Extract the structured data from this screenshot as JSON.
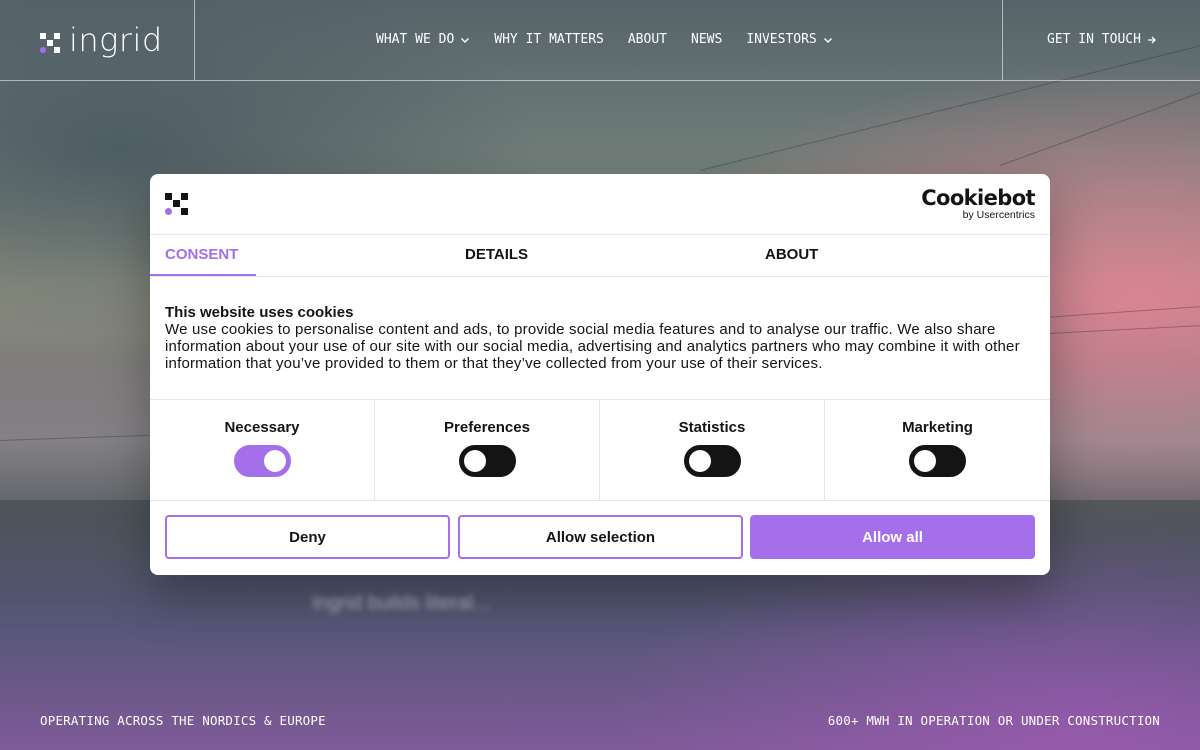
{
  "site": {
    "logo_text": "ingrid",
    "nav": [
      {
        "label": "WHAT WE DO",
        "has_dropdown": true
      },
      {
        "label": "WHY IT MATTERS",
        "has_dropdown": false
      },
      {
        "label": "ABOUT",
        "has_dropdown": false
      },
      {
        "label": "NEWS",
        "has_dropdown": false
      },
      {
        "label": "INVESTORS",
        "has_dropdown": true
      }
    ],
    "cta_label": "GET IN TOUCH",
    "hero_blurred_text": "Ingrid builds literal..."
  },
  "footer": {
    "left": "OPERATING ACROSS THE NORDICS & EUROPE",
    "right": "600+ MWH IN OPERATION OR UNDER CONSTRUCTION"
  },
  "cookie_dialog": {
    "brand": "Cookiebot",
    "brand_sub": "by Usercentrics",
    "tabs": [
      "CONSENT",
      "DETAILS",
      "ABOUT"
    ],
    "active_tab": "CONSENT",
    "title": "This website uses cookies",
    "description": "We use cookies to personalise content and ads, to provide social media features and to analyse our traffic. We also share information about your use of our site with our social media, advertising and analytics partners who may combine it with other information that you’ve provided to them or that they’ve collected from your use of their services.",
    "categories": [
      {
        "label": "Necessary",
        "enabled": true
      },
      {
        "label": "Preferences",
        "enabled": false
      },
      {
        "label": "Statistics",
        "enabled": false
      },
      {
        "label": "Marketing",
        "enabled": false
      }
    ],
    "buttons": {
      "deny": "Deny",
      "allow_selection": "Allow selection",
      "allow_all": "Allow all"
    }
  },
  "colors": {
    "accent": "#a56eea",
    "text": "#141414"
  }
}
